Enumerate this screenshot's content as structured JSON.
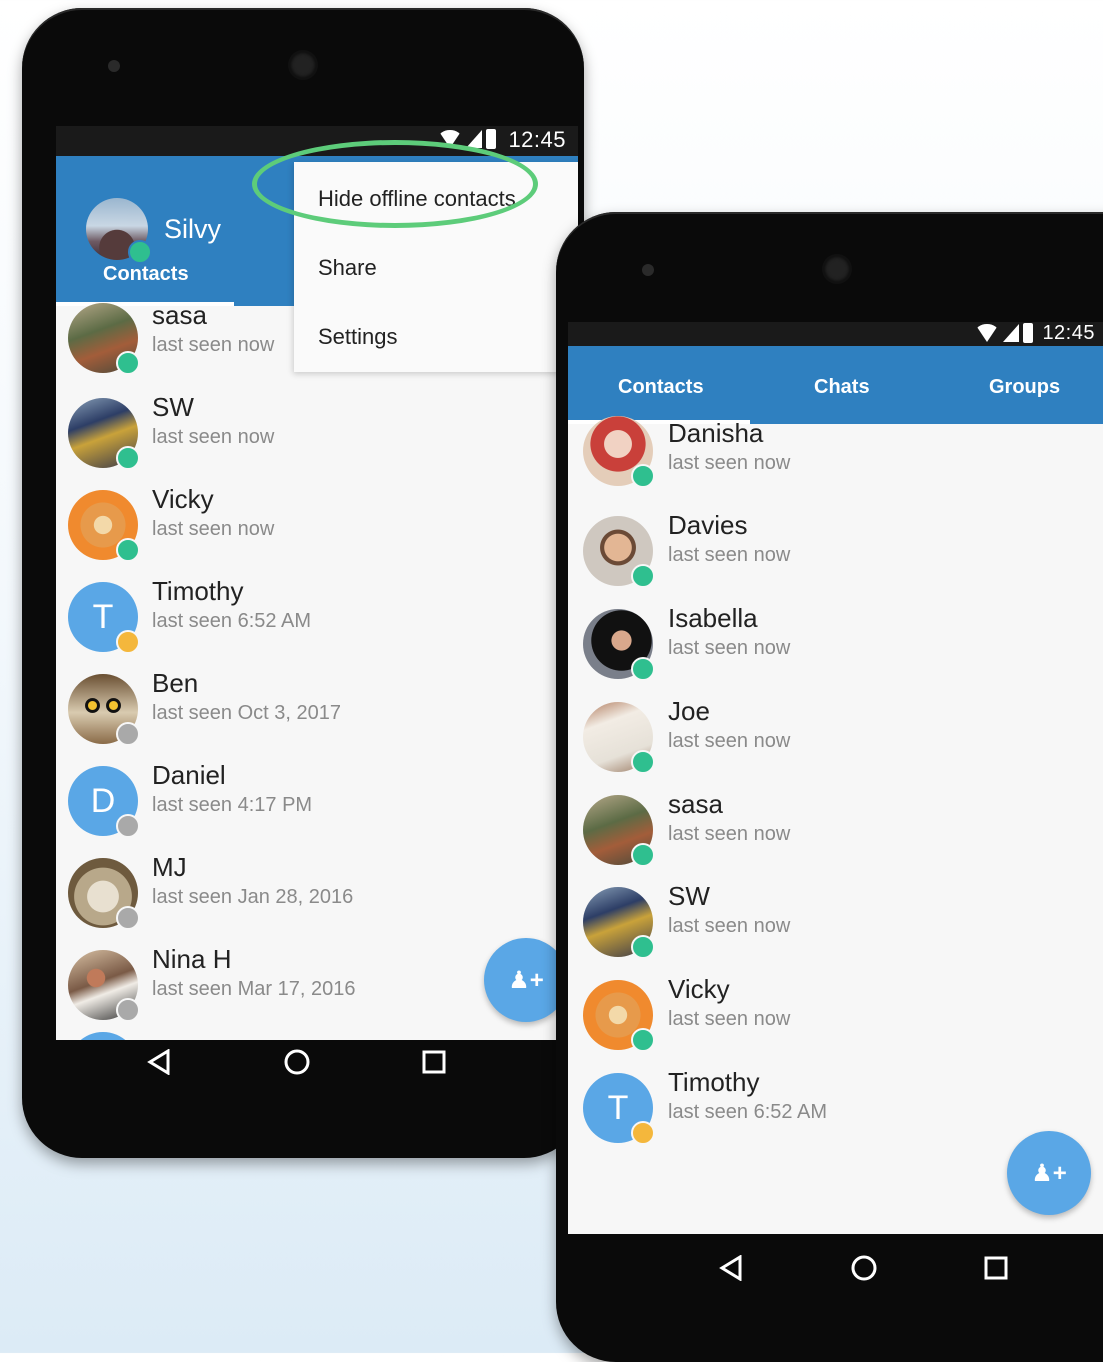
{
  "phone1": {
    "status_time": "12:45",
    "profile_name": "Silvy",
    "tab_label": "Contacts",
    "menu": [
      "Hide offline contacts",
      "Share",
      "Settings"
    ],
    "contacts": [
      {
        "name": "sasa",
        "seen": "last seen now",
        "avatar": "photo",
        "status": "online"
      },
      {
        "name": "SW",
        "seen": "last seen now",
        "avatar": "photo",
        "status": "online"
      },
      {
        "name": "Vicky",
        "seen": "last seen now",
        "avatar": "starfish",
        "status": "online"
      },
      {
        "name": "Timothy",
        "seen": "last seen 6:52 AM",
        "avatar": "letter",
        "letter": "T",
        "status": "away"
      },
      {
        "name": "Ben",
        "seen": "last seen Oct 3, 2017",
        "avatar": "owl",
        "status": "offline"
      },
      {
        "name": "Daniel",
        "seen": "last seen 4:17 PM",
        "avatar": "letter",
        "letter": "D",
        "status": "offline"
      },
      {
        "name": "MJ",
        "seen": "last seen Jan 28, 2016",
        "avatar": "photo",
        "status": "offline"
      },
      {
        "name": "Nina H",
        "seen": "last seen Mar 17, 2016",
        "avatar": "photo",
        "status": "offline"
      }
    ]
  },
  "phone2": {
    "status_time": "12:45",
    "tabs": [
      "Contacts",
      "Chats",
      "Groups"
    ],
    "contacts": [
      {
        "name": "Danisha",
        "seen": "last seen now",
        "status": "online"
      },
      {
        "name": "Davies",
        "seen": "last seen now",
        "status": "online"
      },
      {
        "name": "Isabella",
        "seen": "last seen now",
        "status": "online"
      },
      {
        "name": "Joe",
        "seen": "last seen now",
        "status": "online"
      },
      {
        "name": "sasa",
        "seen": "last seen now",
        "status": "online"
      },
      {
        "name": "SW",
        "seen": "last seen now",
        "status": "online"
      },
      {
        "name": "Vicky",
        "seen": "last seen now",
        "status": "online"
      },
      {
        "name": "Timothy",
        "seen": "last seen 6:52 AM",
        "letter": "T",
        "status": "away"
      }
    ]
  },
  "colors": {
    "primary": "#2f80c0",
    "fab": "#5aa7e6",
    "online": "#2fbf8f",
    "away": "#f4b73c",
    "offline": "#a9a9a9",
    "highlight": "#5dcc7a"
  }
}
